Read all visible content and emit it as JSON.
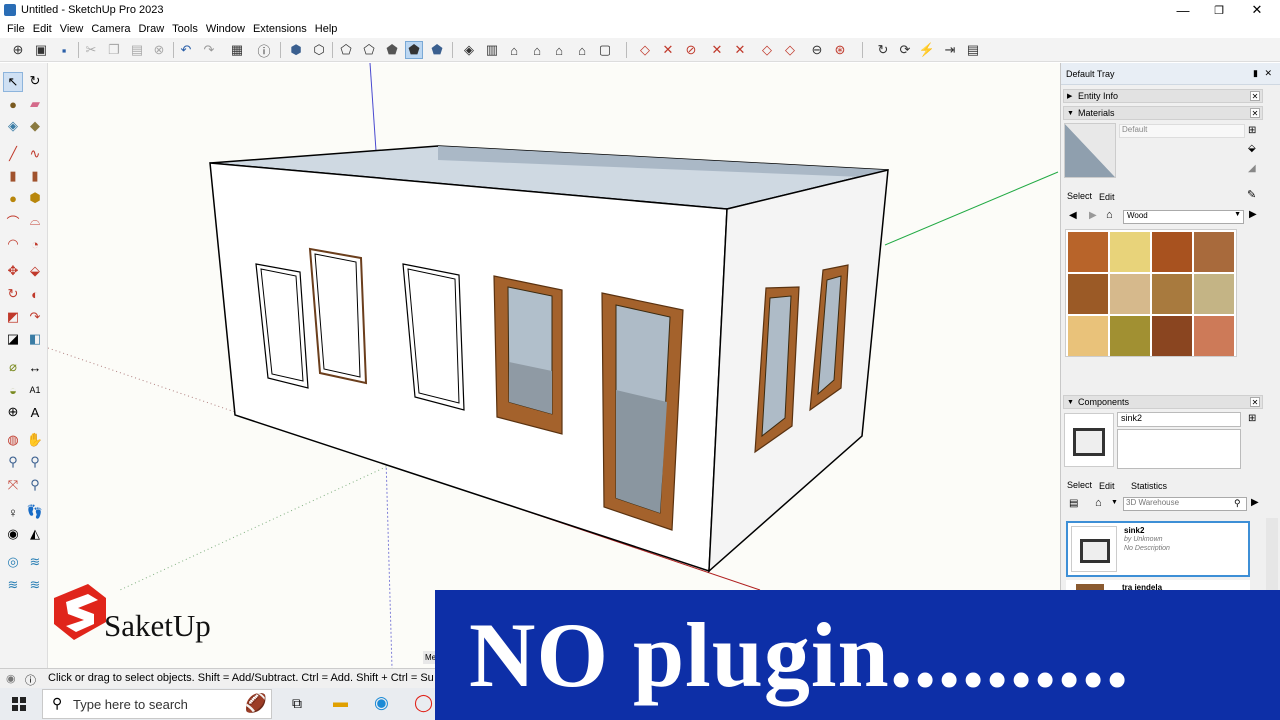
{
  "window": {
    "title": "Untitled - SketchUp Pro 2023",
    "minimize": "—",
    "restore": "❐",
    "close": "✕"
  },
  "menu": [
    "File",
    "Edit",
    "View",
    "Camera",
    "Draw",
    "Tools",
    "Window",
    "Extensions",
    "Help"
  ],
  "tray": {
    "title": "Default Tray",
    "entity_info": "Entity Info",
    "materials": {
      "header": "Materials",
      "current": "Default",
      "tab_select": "Select",
      "tab_edit": "Edit",
      "library": "Wood",
      "swatch_colors": [
        "#b8642a",
        "#e8d37a",
        "#a8521f",
        "#a86a3c",
        "#9b5a26",
        "#d6b98c",
        "#a87a3e",
        "#c4b485",
        "#e9c27a",
        "#a19032",
        "#8a4520",
        "#cd7a58"
      ]
    },
    "components": {
      "header": "Components",
      "name": "sink2",
      "tab_select": "Select",
      "tab_edit": "Edit",
      "tab_statistics": "Statistics",
      "search_placeholder": "3D Warehouse",
      "item_name": "sink2",
      "item_by": "by Unknown",
      "item_desc": "No Description",
      "next_item": "tra jendela"
    }
  },
  "status": {
    "message": "Click or drag to select objects. Shift = Add/Subtract. Ctrl = Add. Shift + Ctrl = Subtract.",
    "measure_label": "Me"
  },
  "taskbar": {
    "search_placeholder": "Type here to search"
  },
  "overlay": {
    "banner_text": "NO plugin..........",
    "logo_text": "SaketUp"
  }
}
